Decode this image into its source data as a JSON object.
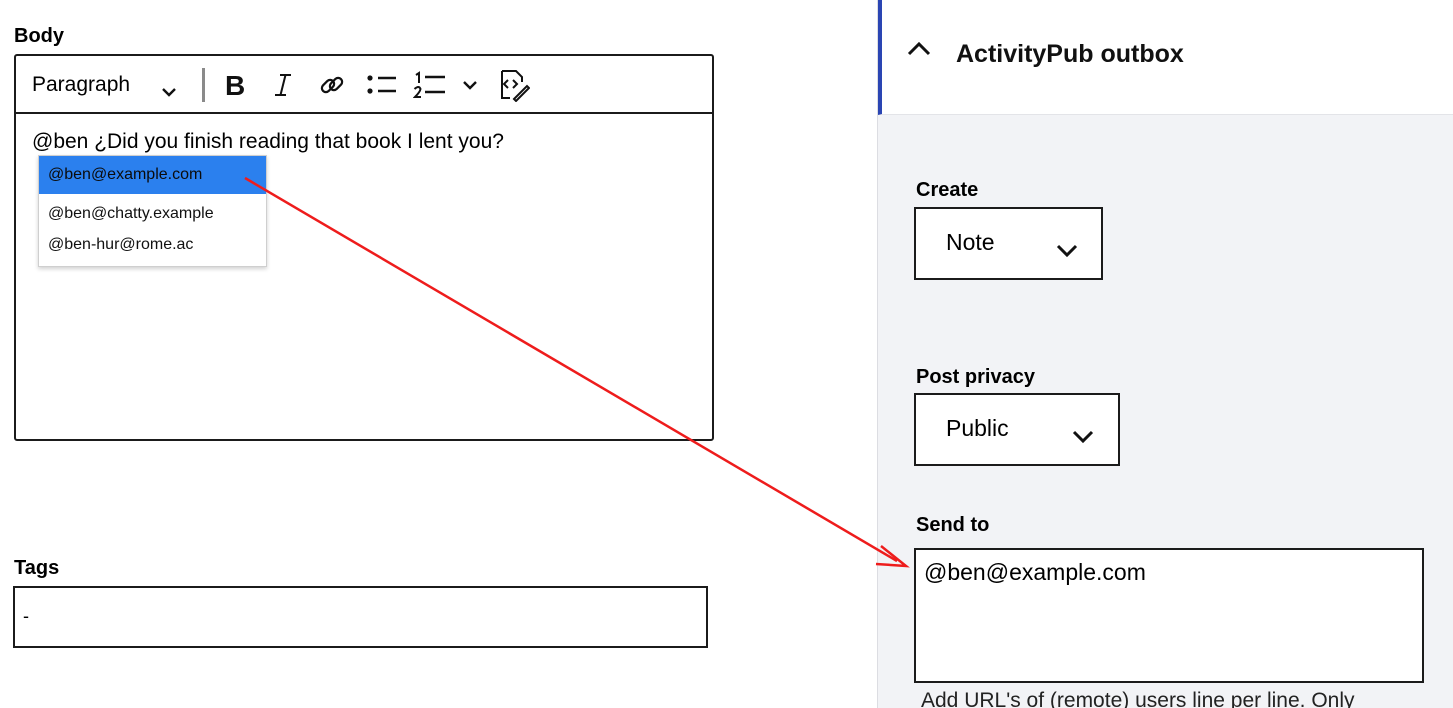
{
  "left": {
    "body_label": "Body",
    "tags_label": "Tags",
    "tags_value": "-"
  },
  "editor": {
    "toolbar": {
      "format_value": "Paragraph",
      "buttons": [
        "bold-icon",
        "italic-icon",
        "link-icon",
        "bulleted-list-icon",
        "numbered-list-icon",
        "chevron-down-icon",
        "source-code-icon"
      ]
    },
    "content": "@ben ¿Did you finish reading that book I lent you?"
  },
  "mention_popup": {
    "items": [
      "@ben@example.com",
      "@ben@chatty.example",
      "@ben-hur@rome.ac"
    ],
    "selected_index": 0
  },
  "panel": {
    "title": "ActivityPub outbox",
    "create_label": "Create",
    "create_value": "Note",
    "privacy_label": "Post privacy",
    "privacy_value": "Public",
    "sendto_label": "Send to",
    "sendto_value": "@ben@example.com",
    "help_text": "Add URL's of (remote) users line per line. Only"
  },
  "colors": {
    "selection": "#2b80ee",
    "panel_bg": "#f2f3f6",
    "panel_accent": "#2a45b3",
    "annotation": "#ee1c1c"
  }
}
